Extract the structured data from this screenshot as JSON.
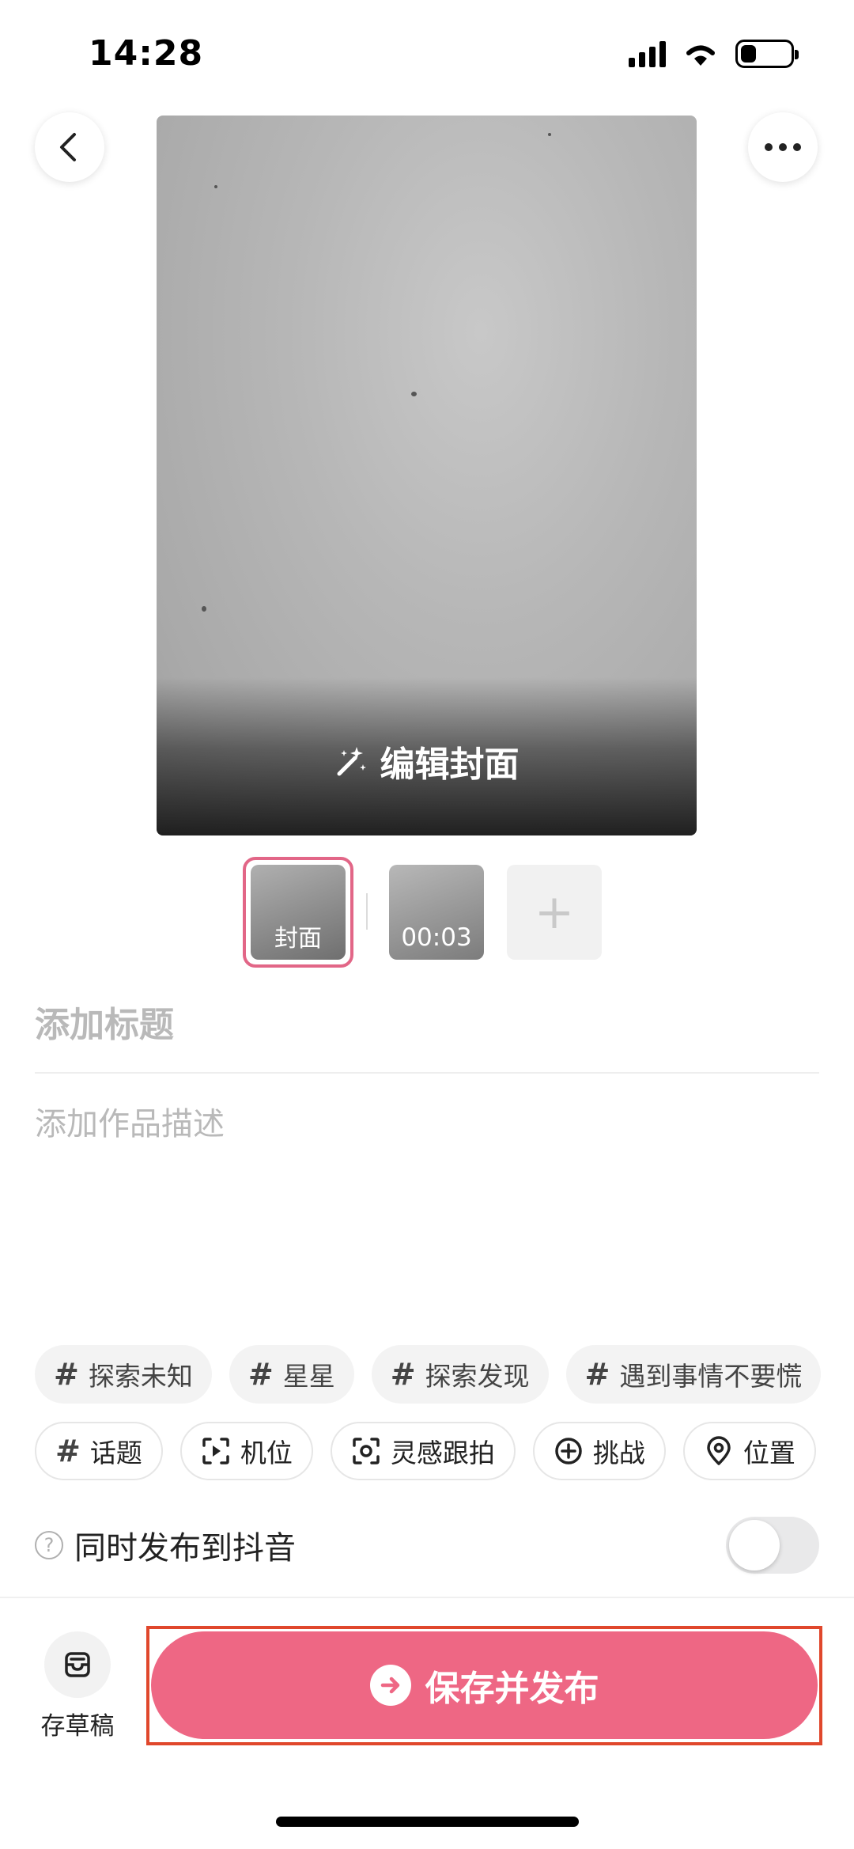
{
  "status_bar": {
    "time": "14:28",
    "battery_level": 0.3
  },
  "header": {
    "back_icon": "chevron-left-icon",
    "more_icon": "more-dots-icon"
  },
  "cover": {
    "edit_label": "编辑封面",
    "edit_icon": "magic-wand-icon"
  },
  "thumbnails": {
    "cover_label": "封面",
    "clip_duration": "00:03",
    "add_label": "+"
  },
  "form": {
    "title_placeholder": "添加标题",
    "description_placeholder": "添加作品描述"
  },
  "topic_suggestions": [
    "探索未知",
    "星星",
    "探索发现",
    "遇到事情不要慌"
  ],
  "tools": [
    {
      "label": "话题",
      "icon": "hashtag-icon"
    },
    {
      "label": "机位",
      "icon": "camera-angle-icon"
    },
    {
      "label": "灵感跟拍",
      "icon": "inspiration-icon"
    },
    {
      "label": "挑战",
      "icon": "challenge-icon"
    },
    {
      "label": "位置",
      "icon": "location-icon"
    }
  ],
  "sync": {
    "label": "同时发布到抖音",
    "enabled": false
  },
  "bottom": {
    "draft_label": "存草稿",
    "publish_label": "保存并发布"
  },
  "colors": {
    "accent": "#ee6784",
    "highlight_border": "#e0472c"
  }
}
